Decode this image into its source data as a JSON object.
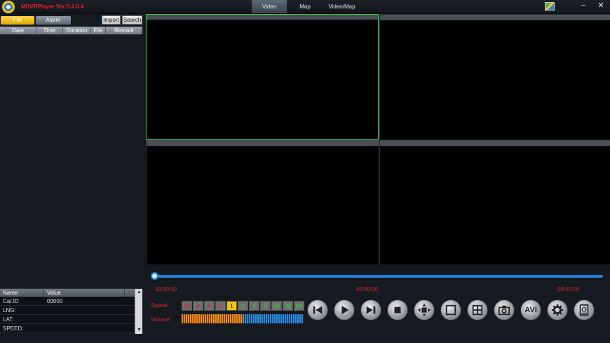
{
  "app": {
    "title": "MDVRPlayer Ver:5.4.0.4"
  },
  "top_tabs": [
    {
      "label": "Video",
      "active": true
    },
    {
      "label": "Map",
      "active": false
    },
    {
      "label": "Video/Map",
      "active": false
    }
  ],
  "window_controls": {
    "minimize": "–",
    "close": "✕"
  },
  "left_panel": {
    "tabs": [
      {
        "label": "File",
        "active": true
      },
      {
        "label": "Alarm",
        "active": false
      }
    ],
    "import_label": "Import",
    "search_label": "Search",
    "file_table_headers": [
      "Date",
      "Time",
      "Duration",
      "File",
      "Remark"
    ],
    "info_headers": [
      "Name",
      "Value"
    ],
    "info_rows": [
      {
        "name": "Car.ID",
        "value": "00000"
      },
      {
        "name": "LNG:",
        "value": ""
      },
      {
        "name": "LAT:",
        "value": ""
      },
      {
        "name": "SPEED:",
        "value": ""
      }
    ]
  },
  "playback": {
    "progress": 0,
    "time_start": "00:00:00",
    "time_mid": "00:00:00",
    "time_end": "00:00:00",
    "speed_label": "Speed:",
    "volume_label": "Volume:",
    "speeds": [
      {
        "label": "16",
        "kind": "slow"
      },
      {
        "label": "8",
        "kind": "slow"
      },
      {
        "label": "4",
        "kind": "slow"
      },
      {
        "label": "2",
        "kind": "slow"
      },
      {
        "label": "1",
        "kind": "norm"
      },
      {
        "label": "2",
        "kind": "fast"
      },
      {
        "label": "4",
        "kind": "fast"
      },
      {
        "label": "8",
        "kind": "fast"
      },
      {
        "label": "16",
        "kind": "fast"
      },
      {
        "label": "32",
        "kind": "fast"
      },
      {
        "label": "64",
        "kind": "fast"
      }
    ],
    "volume_percent": 51,
    "avi_label": "AVI"
  },
  "colors": {
    "accent_blue": "#1f7fd6",
    "red_text": "#e0242a",
    "active_pane": "#2fcf3a"
  }
}
